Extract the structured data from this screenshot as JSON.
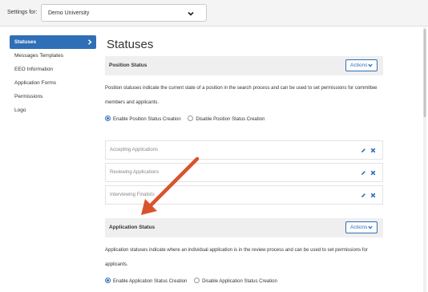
{
  "header": {
    "settings_label": "Settings for:",
    "org_select_value": "Demo University",
    "chevron_icon": "chevron-down-icon"
  },
  "sidebar": {
    "items": [
      {
        "label": "Statuses",
        "active": true
      },
      {
        "label": "Messages Templates",
        "active": false
      },
      {
        "label": "EEO Information",
        "active": false
      },
      {
        "label": "Application Forms",
        "active": false
      },
      {
        "label": "Permissions",
        "active": false
      },
      {
        "label": "Logo",
        "active": false
      }
    ]
  },
  "main": {
    "page_title": "Statuses",
    "position_status": {
      "title": "Position Status",
      "actions_label": "Actions",
      "description": "Position statuses indicate the current state of a position in the search process and can be used to set permissions for committee members and applicants.",
      "radio_enable": "Enable Position Status Creation",
      "radio_disable": "Disable Position Status Creation",
      "selected": "enable",
      "items": [
        {
          "label": "Accepting Applications"
        },
        {
          "label": "Reviewing Applications"
        },
        {
          "label": "Interviewing Finalists"
        }
      ]
    },
    "application_status": {
      "title": "Application Status",
      "actions_label": "Actions",
      "description": "Application statuses indicate where an individual application is in the review process and can be used to set permissions for applicants.",
      "radio_enable": "Enable Application Status Creation",
      "radio_disable": "Disable Application Status Creation",
      "selected": "enable"
    }
  },
  "colors": {
    "accent": "#2f6fb7",
    "annotation_arrow": "#d9532c"
  }
}
